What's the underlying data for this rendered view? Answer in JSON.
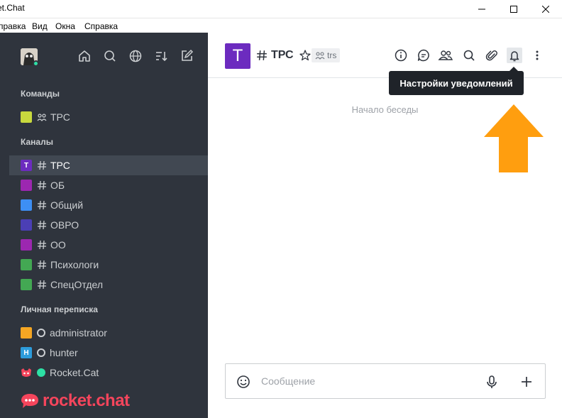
{
  "window": {
    "title": "et.Chat"
  },
  "menu": [
    "правка",
    "Вид",
    "Окна",
    "Справка"
  ],
  "sidebar": {
    "sections": {
      "teams": "Команды",
      "channels": "Каналы",
      "direct": "Личная переписка"
    },
    "teams": [
      {
        "name": "ТРС",
        "color": "#c8d93e"
      }
    ],
    "channels": [
      {
        "name": "ТРС",
        "color": "#6c2bbf",
        "letter": "T",
        "active": true
      },
      {
        "name": "ОБ",
        "color": "#9c27b0",
        "letter": ""
      },
      {
        "name": "Общий",
        "color": "#3d8ff5",
        "letter": ""
      },
      {
        "name": "ОВРО",
        "color": "#4b3fb5",
        "letter": ""
      },
      {
        "name": "ОО",
        "color": "#9c27b0",
        "letter": ""
      },
      {
        "name": "Психологи",
        "color": "#43a853",
        "letter": ""
      },
      {
        "name": "СпецОтдел",
        "color": "#43a853",
        "letter": ""
      }
    ],
    "direct": [
      {
        "name": "administrator",
        "color": "#f5a623",
        "letter": "",
        "status": "offline"
      },
      {
        "name": "hunter",
        "color": "#2d9cdb",
        "letter": "H",
        "status": "offline"
      },
      {
        "name": "Rocket.Cat",
        "color": "",
        "letter": "",
        "status": "online"
      }
    ],
    "logo_text": "rocket.chat"
  },
  "room": {
    "avatar_letter": "T",
    "name": "ТРС",
    "team_tag": "trs",
    "start_text": "Начало беседы",
    "tooltip": "Настройки уведомлений"
  },
  "composer": {
    "placeholder": "Сообщение"
  }
}
